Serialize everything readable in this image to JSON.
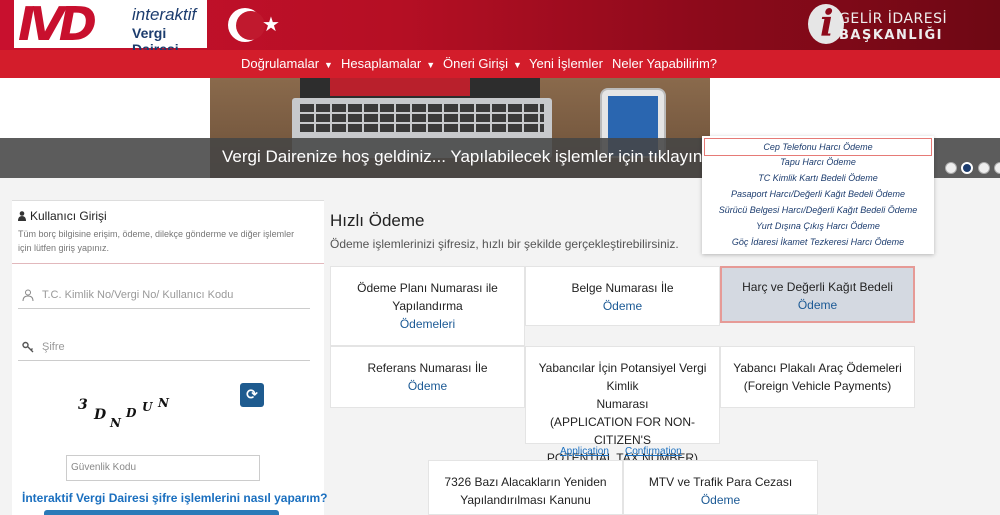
{
  "header": {
    "logo_mark": "IVD",
    "logo_line1": "interaktif",
    "logo_line2": "Vergi Dairesi",
    "gib_line1": "GELİR İDARESİ",
    "gib_line2": "BAŞKANLIĞI"
  },
  "nav": {
    "items": [
      {
        "label": "Doğrulamalar",
        "caret": "▼"
      },
      {
        "label": "Hesaplamalar",
        "caret": "▼"
      },
      {
        "label": "Öneri Girişi",
        "caret": "▼"
      },
      {
        "label": "Yeni İşlemler"
      },
      {
        "label": "Neler Yapabilirim?"
      }
    ]
  },
  "hero": {
    "text": "Vergi Dairenize hoş geldiniz... Yapılabilecek işlemler için tıklayın"
  },
  "login": {
    "title": "Kullanıcı Girişi",
    "description": "Tüm borç bilgisine erişim, ödeme, dilekçe gönderme ve diğer işlemler için lütfen giriş yapınız.",
    "username_placeholder": "T.C. Kimlik No/Vergi No/ Kullanıcı Kodu",
    "password_placeholder": "Şifre",
    "captcha_chars": [
      "3",
      "D",
      "N",
      "D",
      "U",
      "N"
    ],
    "security_placeholder": "Güvenlik Kodu",
    "help_link": "İnteraktif Vergi Dairesi şifre işlemlerini nasıl yaparım?"
  },
  "quick_pay": {
    "title": "Hızlı Ödeme",
    "subtitle": "Ödeme işlemlerinizi şifresiz, hızlı bir şekilde gerçekleştirebilirsiniz.",
    "cards": [
      {
        "title": "Ödeme Planı Numarası ile Yapılandırma",
        "link": "Ödemeleri"
      },
      {
        "title": "Belge Numarası İle",
        "link": "Ödeme"
      },
      {
        "title": "Harç ve Değerli Kağıt Bedeli",
        "link": "Ödeme"
      },
      {
        "title": "Referans Numarası İle",
        "link": "Ödeme"
      },
      {
        "title": "Yabancılar İçin Potansiyel Vergi Kimlik Numarası (APPLICATION FOR NON-CITIZEN'S POTENTIAL TAX NUMBER)",
        "link": ""
      },
      {
        "title": "Yabancı Plakalı Araç Ödemeleri (Foreign Vehicle Payments)",
        "link": ""
      },
      {
        "title": "7326 Bazı Alacakların Yeniden Yapılandırılması Kanunu",
        "link": ""
      },
      {
        "title": "MTV ve Trafik Para Cezası",
        "link": "Ödeme"
      }
    ],
    "card5_line1": "Yabancılar İçin Potansiyel Vergi Kimlik",
    "card5_line2": "Numarası",
    "card5_line3": "(APPLICATION FOR NON-CITIZEN'S",
    "card5_line4": "POTENTIAL TAX NUMBER)",
    "card6_line1": "Yabancı Plakalı Araç Ödemeleri",
    "card6_line2": "(Foreign Vehicle Payments)",
    "card1_line1": "Ödeme Planı Numarası ile",
    "card1_line2": "Yapılandırma",
    "card7_line1": "7326 Bazı Alacakların Yeniden",
    "card7_line2": "Yapılandırılması Kanunu",
    "application_link": "Application",
    "confirmation_link": "Confirmation"
  },
  "dropdown": {
    "items": [
      "Cep Telefonu Harcı Ödeme",
      "Tapu Harcı Ödeme",
      "TC Kimlik Kartı Bedeli Ödeme",
      "Pasaport Harcı/Değerli Kağıt Bedeli Ödeme",
      "Sürücü Belgesi Harcı/Değerli Kağıt Bedeli Ödeme",
      "Yurt Dışına Çıkış Harcı Ödeme",
      "Göç İdaresi İkamet Tezkeresi Harcı Ödeme"
    ]
  },
  "colors": {
    "brand_red": "#d31d2b",
    "brand_navy": "#1c3c6e",
    "link_blue": "#1a6fbf"
  }
}
